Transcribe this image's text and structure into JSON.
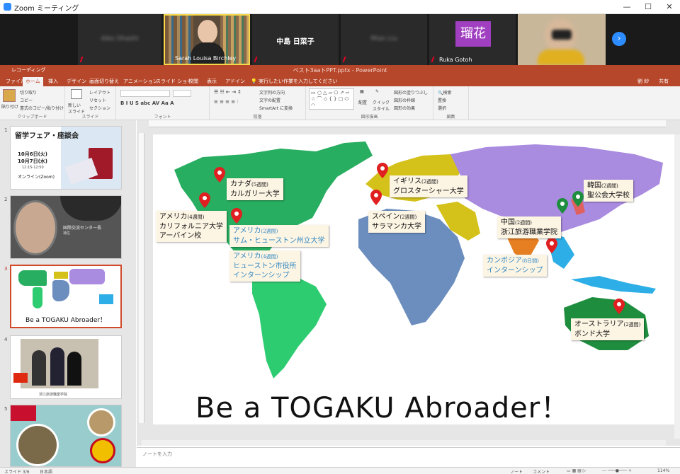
{
  "zoom": {
    "title": "Zoom ミーティング",
    "win_min": "—",
    "win_max": "☐",
    "win_close": "✕"
  },
  "participants": [
    {
      "name": "Sarah Louisa Birchley"
    },
    {
      "name": "中島 日菜子"
    },
    {
      "name": "瑠花",
      "avatar": "瑠花",
      "label": "Ruka Gotoh"
    }
  ],
  "ppt": {
    "title": "ペスト3aaトPPT.pptx - PowerPoint",
    "search": "実行したい作業を入力してください",
    "user": "劉 紗",
    "share": "共有",
    "qa": "レコーディング"
  },
  "tabs": [
    "ファイル",
    "ホーム",
    "挿入",
    "デザイン",
    "画面切り替え",
    "アニメーション",
    "スライド ショー",
    "校閲",
    "表示",
    "アドイン"
  ],
  "ribbon": {
    "clipboard": {
      "label": "クリップボード",
      "paste": "貼り付け",
      "cut": "切り取り",
      "copy": "コピー",
      "format": "書式のコピー/貼り付け"
    },
    "slides": {
      "label": "スライド",
      "new": "新しい\nスライド",
      "layout": "レイアウト",
      "reset": "リセット",
      "section": "セクション"
    },
    "font": {
      "label": "フォント"
    },
    "paragraph": {
      "label": "段落",
      "dir": "文字列の方向",
      "align": "文字の配置",
      "smartart": "SmartArt に変換"
    },
    "drawing": {
      "label": "図形描画",
      "arrange": "配置",
      "quick": "クイック\nスタイル",
      "fill": "図形の塗りつぶし",
      "outline": "図形の枠線",
      "effect": "図形の効果"
    },
    "edit": {
      "label": "編集",
      "find": "検索",
      "replace": "置換",
      "select": "選択"
    }
  },
  "thumbs": [
    {
      "num": "1",
      "title": "留学フェア・座談会",
      "d1": "10月6日(火)",
      "d2": "10月7日(水)",
      "time": "12:15-12:50",
      "online": "オンライン(Zoom)"
    },
    {
      "num": "2",
      "text": "国際交流センター長",
      "sub": "補佐"
    },
    {
      "num": "3",
      "caption": "Be a TOGAKU Abroader！"
    },
    {
      "num": "4",
      "caption": "浙江旅游職業学院"
    },
    {
      "num": "5"
    }
  ],
  "labels": [
    {
      "l1": "カナダ",
      "s1": "(5週間)",
      "l2": "カルガリー大学"
    },
    {
      "l1": "アメリカ",
      "s1": "(4週間)",
      "l2": "カリフォルニア大学",
      "l3": "アーバイン校"
    },
    {
      "l1": "アメリカ",
      "s1": "(2週間)",
      "l2": "サム・ヒューストン州立大学"
    },
    {
      "l1": "アメリカ",
      "s1": "(4週間)",
      "l2": "ヒューストン市役所",
      "l3": "インターンシップ"
    },
    {
      "l1": "イギリス",
      "s1": "(2週間)",
      "l2": "グロスターシャー大学"
    },
    {
      "l1": "スペイン",
      "s1": "(2週間)",
      "l2": "サラマンカ大学"
    },
    {
      "l1": "中国",
      "s1": "(2週間)",
      "l2": "浙江旅游職業学院"
    },
    {
      "l1": "カンボジア",
      "s1": "(8日間)",
      "l2": "インターンシップ"
    },
    {
      "l1": "韓国",
      "s1": "(2週間)",
      "l2": "聖公会大学校"
    },
    {
      "l1": "オーストラリア",
      "s1": "(2週間)",
      "l2": "ボンド大学"
    }
  ],
  "banner": "Be a TOGAKU Abroader！",
  "notes": "ノートを入力",
  "status": {
    "slide": "スライド 3/6",
    "lang": "日本語",
    "notes": "ノート",
    "comments": "コメント",
    "zoom": "114%"
  },
  "colors": {
    "ppt": "#b7472a",
    "na": "#27ae60",
    "sa": "#2ecc71",
    "africa": "#6c8ebf",
    "europe": "#d4c21a",
    "asia": "#a98be0",
    "oceania": "#2eaee6",
    "pin": "#e02020",
    "pin_green": "#1e8e3e"
  }
}
